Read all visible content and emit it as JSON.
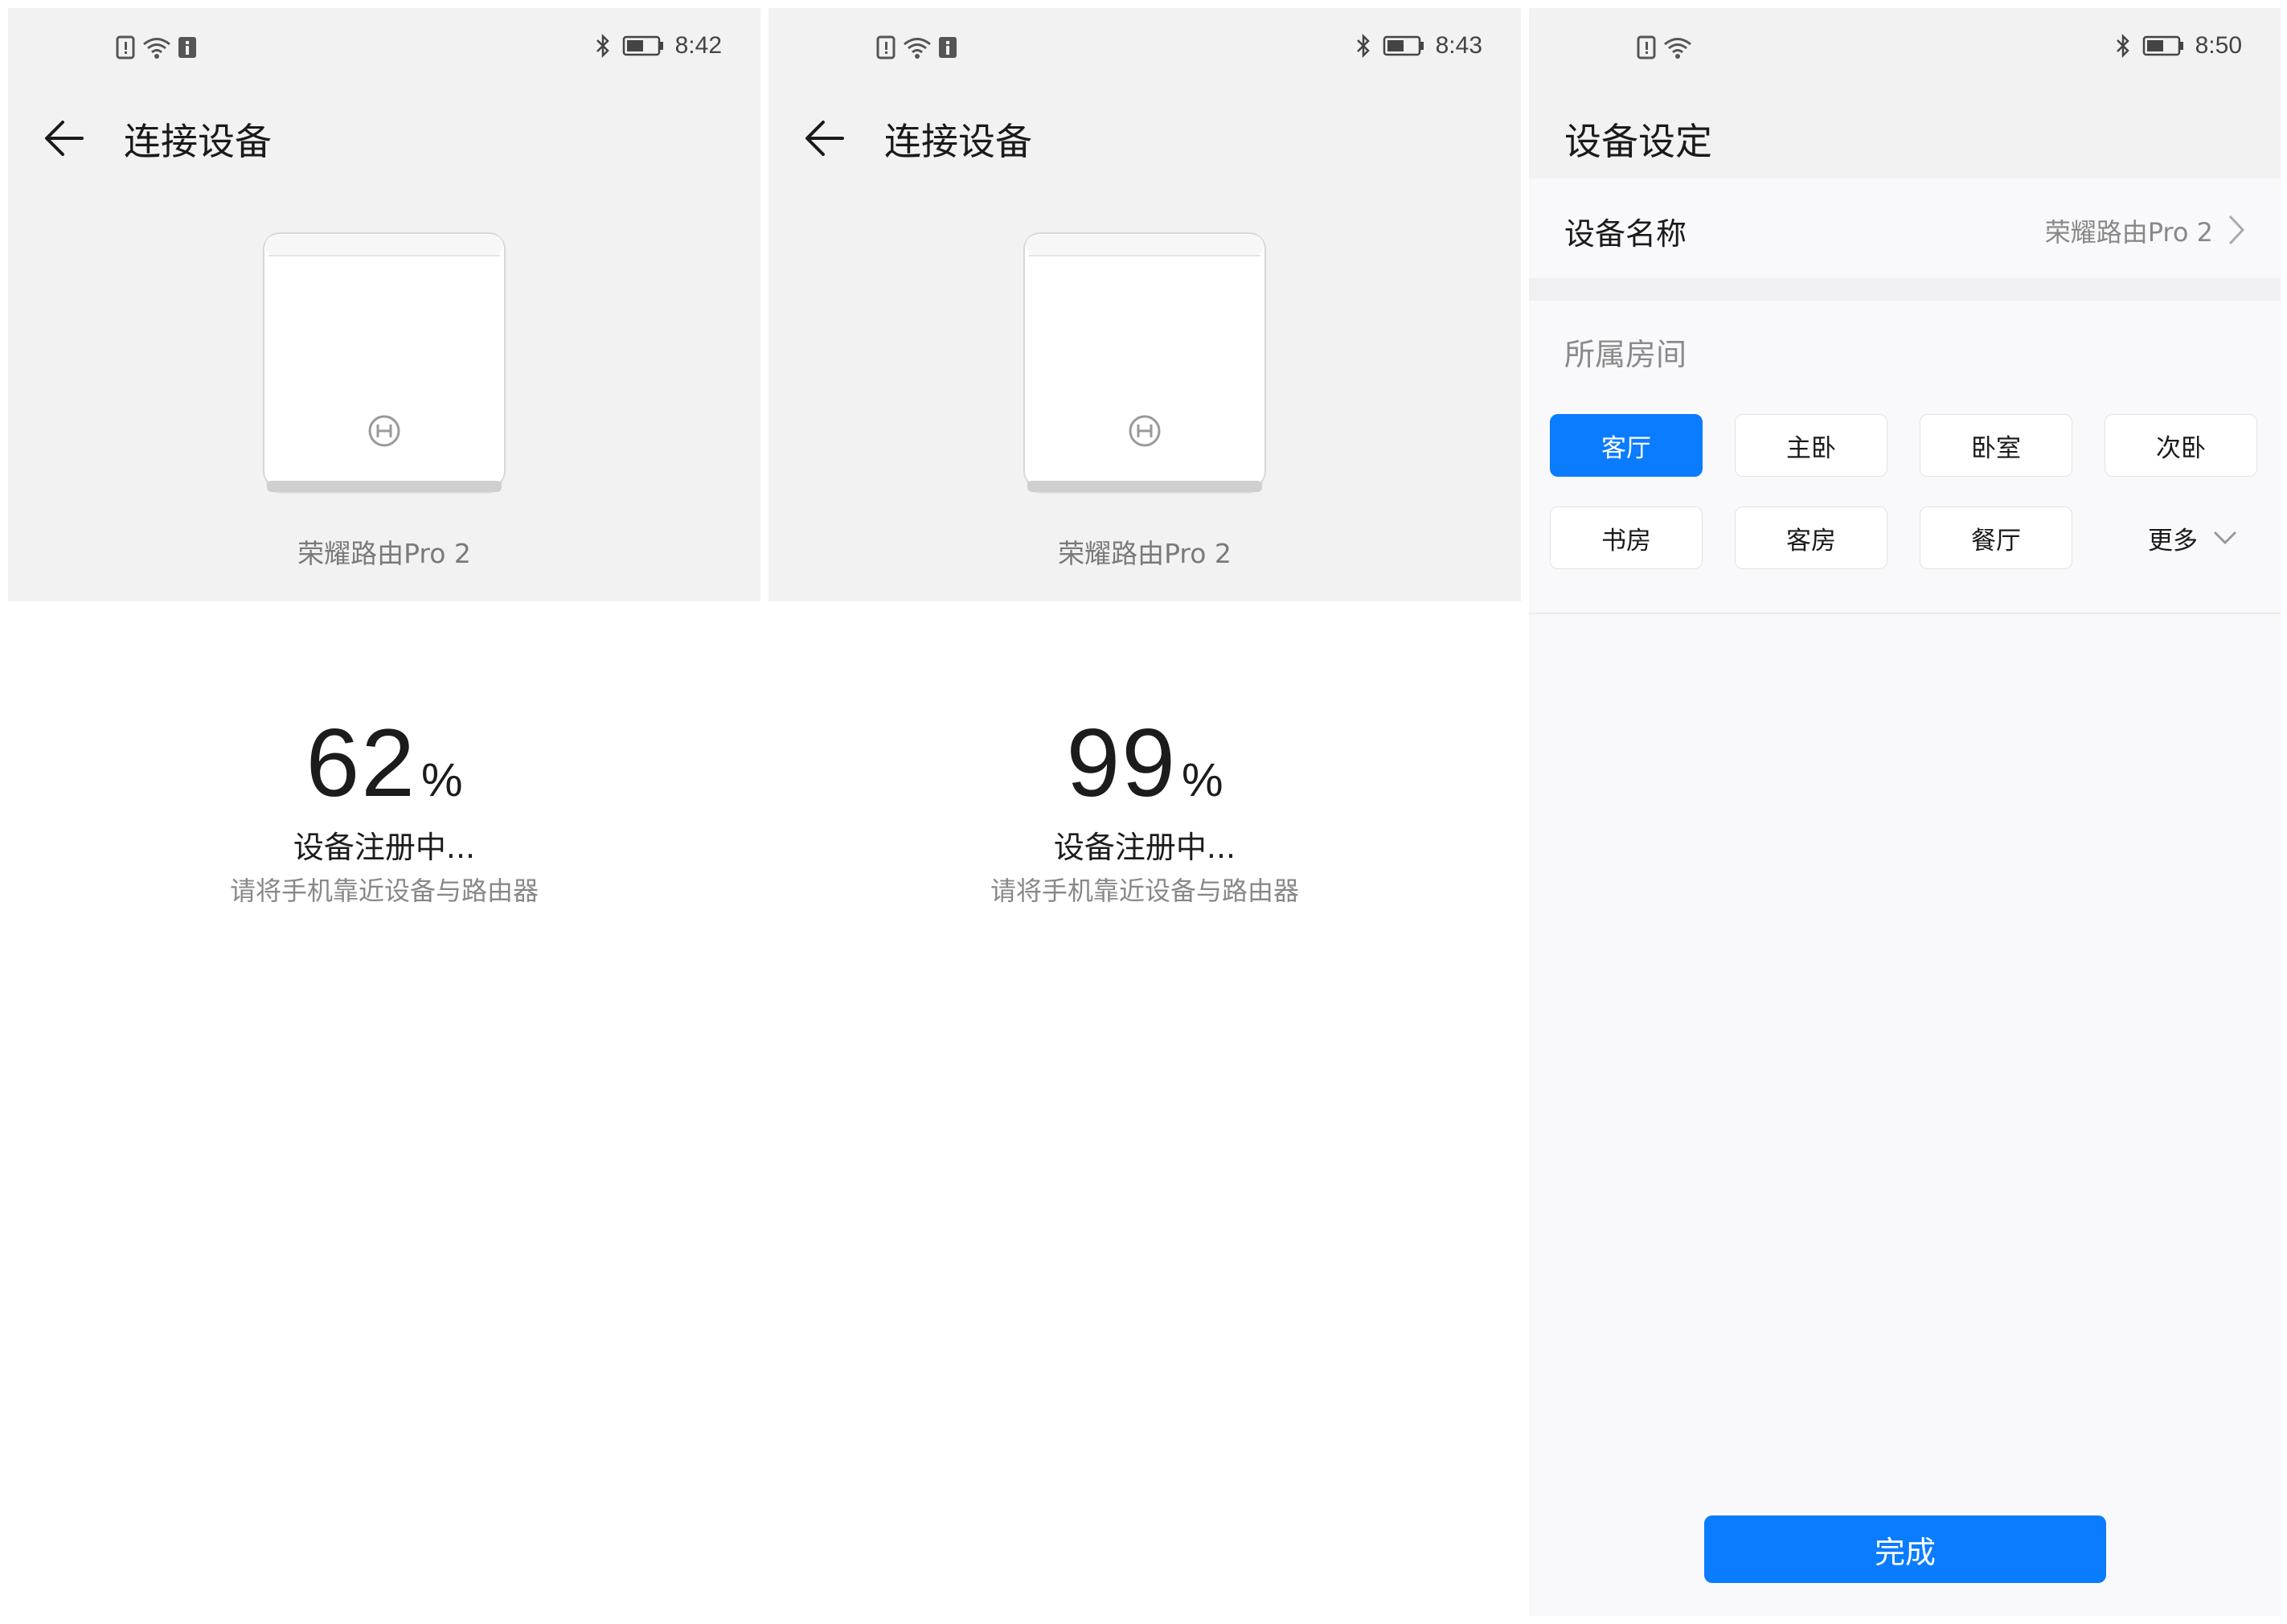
{
  "screens": [
    {
      "status_time": "8:42",
      "title": "连接设备",
      "device_name": "荣耀路由Pro 2",
      "progress_value": "62",
      "progress_unit": "%",
      "status_text": "设备注册中...",
      "hint_text": "请将手机靠近设备与路由器"
    },
    {
      "status_time": "8:43",
      "title": "连接设备",
      "device_name": "荣耀路由Pro 2",
      "progress_value": "99",
      "progress_unit": "%",
      "status_text": "设备注册中...",
      "hint_text": "请将手机靠近设备与路由器"
    }
  ],
  "settings": {
    "status_time": "8:50",
    "title": "设备设定",
    "name_label": "设备名称",
    "name_value": "荣耀路由Pro 2",
    "room_label": "所属房间",
    "rooms": [
      "客厅",
      "主卧",
      "卧室",
      "次卧",
      "书房",
      "客房",
      "餐厅"
    ],
    "selected_room": "客厅",
    "more_label": "更多",
    "done_label": "完成"
  },
  "colors": {
    "accent": "#0a7cff",
    "header_bg": "#f2f2f2",
    "text_primary": "#1a1a1a",
    "text_secondary": "#888888"
  },
  "icons": {
    "status_left": [
      "sim-alert-icon",
      "wifi-icon",
      "info-icon"
    ],
    "status_right": [
      "bluetooth-icon",
      "battery-icon"
    ],
    "back": "back-arrow-icon",
    "chevron": "chevron-right-icon",
    "dropdown": "chevron-down-icon"
  }
}
